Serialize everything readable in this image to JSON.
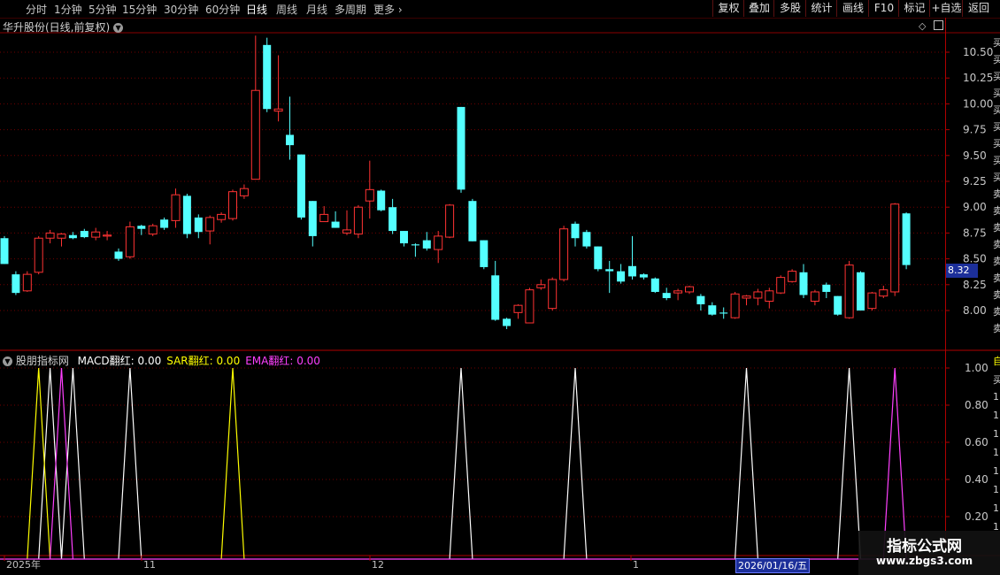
{
  "toolbar": {
    "periods": [
      "分时",
      "1分钟",
      "5分钟",
      "15分钟",
      "30分钟",
      "60分钟",
      "日线",
      "周线",
      "月线",
      "多周期",
      "更多"
    ],
    "active_period": "日线",
    "right_buttons": [
      "复权",
      "叠加",
      "多股",
      "统计",
      "画线",
      "F10",
      "标记",
      "+自选",
      "返回"
    ]
  },
  "main_panel": {
    "title": "华升股份(日线,前复权)",
    "price_axis": [
      "10.50",
      "10.25",
      "10.00",
      "9.75",
      "9.50",
      "9.25",
      "9.00",
      "8.75",
      "8.50",
      "8.25",
      "8.00"
    ],
    "current_price": "8.32",
    "right_edge_chars": [
      "买",
      "买",
      "买",
      "买",
      "买",
      "买",
      "买",
      "买",
      "买",
      "卖",
      "卖",
      "卖",
      "卖",
      "卖",
      "卖",
      "卖",
      "卖",
      "卖"
    ]
  },
  "indicator_panel": {
    "title": "股朋指标网",
    "labels": [
      {
        "text": "MACD翻红: 0.00",
        "color": "#ffffff"
      },
      {
        "text": "SAR翻红: 0.00",
        "color": "#ffff00"
      },
      {
        "text": "EMA翻红: 0.00",
        "color": "#ff40ff"
      }
    ],
    "value_axis": [
      "1.00",
      "0.80",
      "0.60",
      "0.40",
      "0.20"
    ],
    "right_edge_chars": [
      "自",
      "买",
      "1",
      "1",
      "1",
      "1",
      "1",
      "1",
      "1",
      "1"
    ]
  },
  "date_axis": {
    "labels": [
      "2025年",
      "11",
      "12",
      "1"
    ],
    "cursor_date": "2026/01/16/五"
  },
  "watermark": {
    "line1": "指标公式网",
    "line2": "www.zbgs3.com"
  },
  "chart_data": {
    "type": "candlestick",
    "ylim": [
      7.85,
      10.75
    ],
    "colors": {
      "up": "#ff3333",
      "down": "#54ffff"
    },
    "candles": [
      {
        "o": 8.7,
        "h": 8.72,
        "l": 8.45,
        "c": 8.45
      },
      {
        "o": 8.35,
        "h": 8.38,
        "l": 8.15,
        "c": 8.17
      },
      {
        "o": 8.19,
        "h": 8.38,
        "l": 8.18,
        "c": 8.35
      },
      {
        "o": 8.37,
        "h": 8.72,
        "l": 8.35,
        "c": 8.7
      },
      {
        "o": 8.7,
        "h": 8.78,
        "l": 8.65,
        "c": 8.75
      },
      {
        "o": 8.7,
        "h": 8.75,
        "l": 8.62,
        "c": 8.74
      },
      {
        "o": 8.73,
        "h": 8.76,
        "l": 8.69,
        "c": 8.7
      },
      {
        "o": 8.77,
        "h": 8.79,
        "l": 8.7,
        "c": 8.71
      },
      {
        "o": 8.71,
        "h": 8.8,
        "l": 8.68,
        "c": 8.76
      },
      {
        "o": 8.72,
        "h": 8.77,
        "l": 8.68,
        "c": 8.73
      },
      {
        "o": 8.57,
        "h": 8.6,
        "l": 8.48,
        "c": 8.5
      },
      {
        "o": 8.52,
        "h": 8.86,
        "l": 8.5,
        "c": 8.81
      },
      {
        "o": 8.82,
        "h": 8.83,
        "l": 8.73,
        "c": 8.79
      },
      {
        "o": 8.74,
        "h": 8.84,
        "l": 8.72,
        "c": 8.82
      },
      {
        "o": 8.88,
        "h": 8.9,
        "l": 8.78,
        "c": 8.8
      },
      {
        "o": 8.87,
        "h": 9.18,
        "l": 8.8,
        "c": 9.12
      },
      {
        "o": 9.11,
        "h": 9.13,
        "l": 8.7,
        "c": 8.74
      },
      {
        "o": 8.9,
        "h": 8.93,
        "l": 8.7,
        "c": 8.76
      },
      {
        "o": 8.77,
        "h": 8.92,
        "l": 8.64,
        "c": 8.9
      },
      {
        "o": 8.88,
        "h": 8.95,
        "l": 8.85,
        "c": 8.93
      },
      {
        "o": 8.89,
        "h": 9.17,
        "l": 8.87,
        "c": 9.15
      },
      {
        "o": 9.11,
        "h": 9.22,
        "l": 9.08,
        "c": 9.18
      },
      {
        "o": 9.27,
        "h": 10.66,
        "l": 9.27,
        "c": 10.13
      },
      {
        "o": 10.57,
        "h": 10.64,
        "l": 9.92,
        "c": 9.95
      },
      {
        "o": 9.93,
        "h": 10.47,
        "l": 9.83,
        "c": 9.95
      },
      {
        "o": 9.7,
        "h": 10.07,
        "l": 9.46,
        "c": 9.6
      },
      {
        "o": 9.51,
        "h": 9.51,
        "l": 8.88,
        "c": 8.9
      },
      {
        "o": 9.06,
        "h": 9.06,
        "l": 8.62,
        "c": 8.72
      },
      {
        "o": 8.86,
        "h": 9.01,
        "l": 8.86,
        "c": 8.93
      },
      {
        "o": 8.86,
        "h": 8.96,
        "l": 8.8,
        "c": 8.8
      },
      {
        "o": 8.75,
        "h": 8.97,
        "l": 8.73,
        "c": 8.78
      },
      {
        "o": 8.74,
        "h": 9.02,
        "l": 8.7,
        "c": 9.0
      },
      {
        "o": 9.06,
        "h": 9.45,
        "l": 8.89,
        "c": 9.17
      },
      {
        "o": 9.16,
        "h": 9.17,
        "l": 8.96,
        "c": 8.97
      },
      {
        "o": 9.0,
        "h": 9.08,
        "l": 8.74,
        "c": 8.77
      },
      {
        "o": 8.77,
        "h": 8.77,
        "l": 8.62,
        "c": 8.65
      },
      {
        "o": 8.64,
        "h": 8.65,
        "l": 8.52,
        "c": 8.63
      },
      {
        "o": 8.68,
        "h": 8.76,
        "l": 8.58,
        "c": 8.6
      },
      {
        "o": 8.59,
        "h": 8.77,
        "l": 8.46,
        "c": 8.72
      },
      {
        "o": 8.71,
        "h": 9.03,
        "l": 8.7,
        "c": 9.02
      },
      {
        "o": 9.97,
        "h": 9.97,
        "l": 9.14,
        "c": 9.17
      },
      {
        "o": 9.06,
        "h": 9.08,
        "l": 8.67,
        "c": 8.67
      },
      {
        "o": 8.68,
        "h": 8.68,
        "l": 8.4,
        "c": 8.42
      },
      {
        "o": 8.34,
        "h": 8.48,
        "l": 7.9,
        "c": 7.91
      },
      {
        "o": 7.92,
        "h": 7.93,
        "l": 7.82,
        "c": 7.85
      },
      {
        "o": 7.98,
        "h": 8.06,
        "l": 7.92,
        "c": 8.05
      },
      {
        "o": 7.88,
        "h": 8.22,
        "l": 7.88,
        "c": 8.2
      },
      {
        "o": 8.22,
        "h": 8.3,
        "l": 8.2,
        "c": 8.25
      },
      {
        "o": 8.02,
        "h": 8.32,
        "l": 8.0,
        "c": 8.3
      },
      {
        "o": 8.3,
        "h": 8.82,
        "l": 8.28,
        "c": 8.79
      },
      {
        "o": 8.84,
        "h": 8.86,
        "l": 8.62,
        "c": 8.7
      },
      {
        "o": 8.76,
        "h": 8.78,
        "l": 8.6,
        "c": 8.62
      },
      {
        "o": 8.62,
        "h": 8.62,
        "l": 8.38,
        "c": 8.4
      },
      {
        "o": 8.4,
        "h": 8.48,
        "l": 8.17,
        "c": 8.38
      },
      {
        "o": 8.38,
        "h": 8.45,
        "l": 8.26,
        "c": 8.28
      },
      {
        "o": 8.43,
        "h": 8.72,
        "l": 8.3,
        "c": 8.33
      },
      {
        "o": 8.35,
        "h": 8.36,
        "l": 8.3,
        "c": 8.32
      },
      {
        "o": 8.31,
        "h": 8.32,
        "l": 8.17,
        "c": 8.18
      },
      {
        "o": 8.17,
        "h": 8.22,
        "l": 8.1,
        "c": 8.12
      },
      {
        "o": 8.17,
        "h": 8.21,
        "l": 8.1,
        "c": 8.19
      },
      {
        "o": 8.18,
        "h": 8.24,
        "l": 8.16,
        "c": 8.23
      },
      {
        "o": 8.14,
        "h": 8.16,
        "l": 8.0,
        "c": 8.06
      },
      {
        "o": 8.05,
        "h": 8.08,
        "l": 7.95,
        "c": 7.96
      },
      {
        "o": 7.98,
        "h": 8.03,
        "l": 7.92,
        "c": 7.97
      },
      {
        "o": 7.93,
        "h": 8.18,
        "l": 7.92,
        "c": 8.16
      },
      {
        "o": 8.12,
        "h": 8.15,
        "l": 8.05,
        "c": 8.14
      },
      {
        "o": 8.12,
        "h": 8.21,
        "l": 8.05,
        "c": 8.18
      },
      {
        "o": 8.09,
        "h": 8.22,
        "l": 8.02,
        "c": 8.19
      },
      {
        "o": 8.17,
        "h": 8.34,
        "l": 8.16,
        "c": 8.32
      },
      {
        "o": 8.28,
        "h": 8.4,
        "l": 8.27,
        "c": 8.38
      },
      {
        "o": 8.37,
        "h": 8.45,
        "l": 8.12,
        "c": 8.15
      },
      {
        "o": 8.09,
        "h": 8.2,
        "l": 8.05,
        "c": 8.18
      },
      {
        "o": 8.25,
        "h": 8.27,
        "l": 8.12,
        "c": 8.18
      },
      {
        "o": 8.14,
        "h": 8.14,
        "l": 7.95,
        "c": 7.96
      },
      {
        "o": 7.93,
        "h": 8.48,
        "l": 7.92,
        "c": 8.44
      },
      {
        "o": 8.37,
        "h": 8.38,
        "l": 8.0,
        "c": 8.0
      },
      {
        "o": 8.02,
        "h": 8.18,
        "l": 8.0,
        "c": 8.17
      },
      {
        "o": 8.14,
        "h": 8.24,
        "l": 8.12,
        "c": 8.2
      },
      {
        "o": 8.18,
        "h": 9.04,
        "l": 8.14,
        "c": 9.03
      },
      {
        "o": 8.94,
        "h": 8.95,
        "l": 8.4,
        "c": 8.44
      }
    ],
    "indicator": {
      "series": [
        {
          "name": "MACD翻红",
          "color": "#ffffff",
          "signals": [
            4,
            6,
            11,
            40,
            50,
            65,
            74
          ]
        },
        {
          "name": "SAR翻红",
          "color": "#ffff00",
          "signals": [
            3,
            20
          ]
        },
        {
          "name": "EMA翻红",
          "color": "#ff40ff",
          "signals": [
            5,
            78
          ]
        }
      ],
      "ylim": [
        0,
        1.0
      ]
    }
  }
}
